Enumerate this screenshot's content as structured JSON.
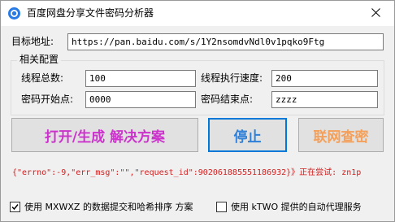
{
  "window": {
    "title": "百度网盘分享文件密码分析器",
    "close_glyph": "✕"
  },
  "target": {
    "label": "目标地址:",
    "value": "https://pan.baidu.com/s/1Y2nsomdvNdl0v1pqko9Ftg"
  },
  "config": {
    "group_title": "相关配置",
    "total_threads_label": "线程总数:",
    "total_threads_value": "100",
    "thread_speed_label": "线程执行速度:",
    "thread_speed_value": "200",
    "pwd_start_label": "密码开始点:",
    "pwd_start_value": "0000",
    "pwd_end_label": "密码结束点:",
    "pwd_end_value": "zzzz"
  },
  "buttons": {
    "open_label": "打开/生成 解决方案",
    "stop_label": "停止",
    "query_label": "联网查密"
  },
  "status": {
    "text": "{\"errno\":-9,\"err_msg\":\"\",\"request_id\":902061885551186932}》正在尝试: zn1p"
  },
  "options": {
    "opt1_label": "使用 MXWXZ 的数据提交和哈希排序 方案",
    "opt2_label": "使用 kTWO 提供的自动代理服务"
  },
  "colors": {
    "open_button_text": "#cc33cc",
    "stop_button_text": "#2f80d8",
    "query_button_text": "#f5a05a",
    "status_text": "#d42020"
  }
}
